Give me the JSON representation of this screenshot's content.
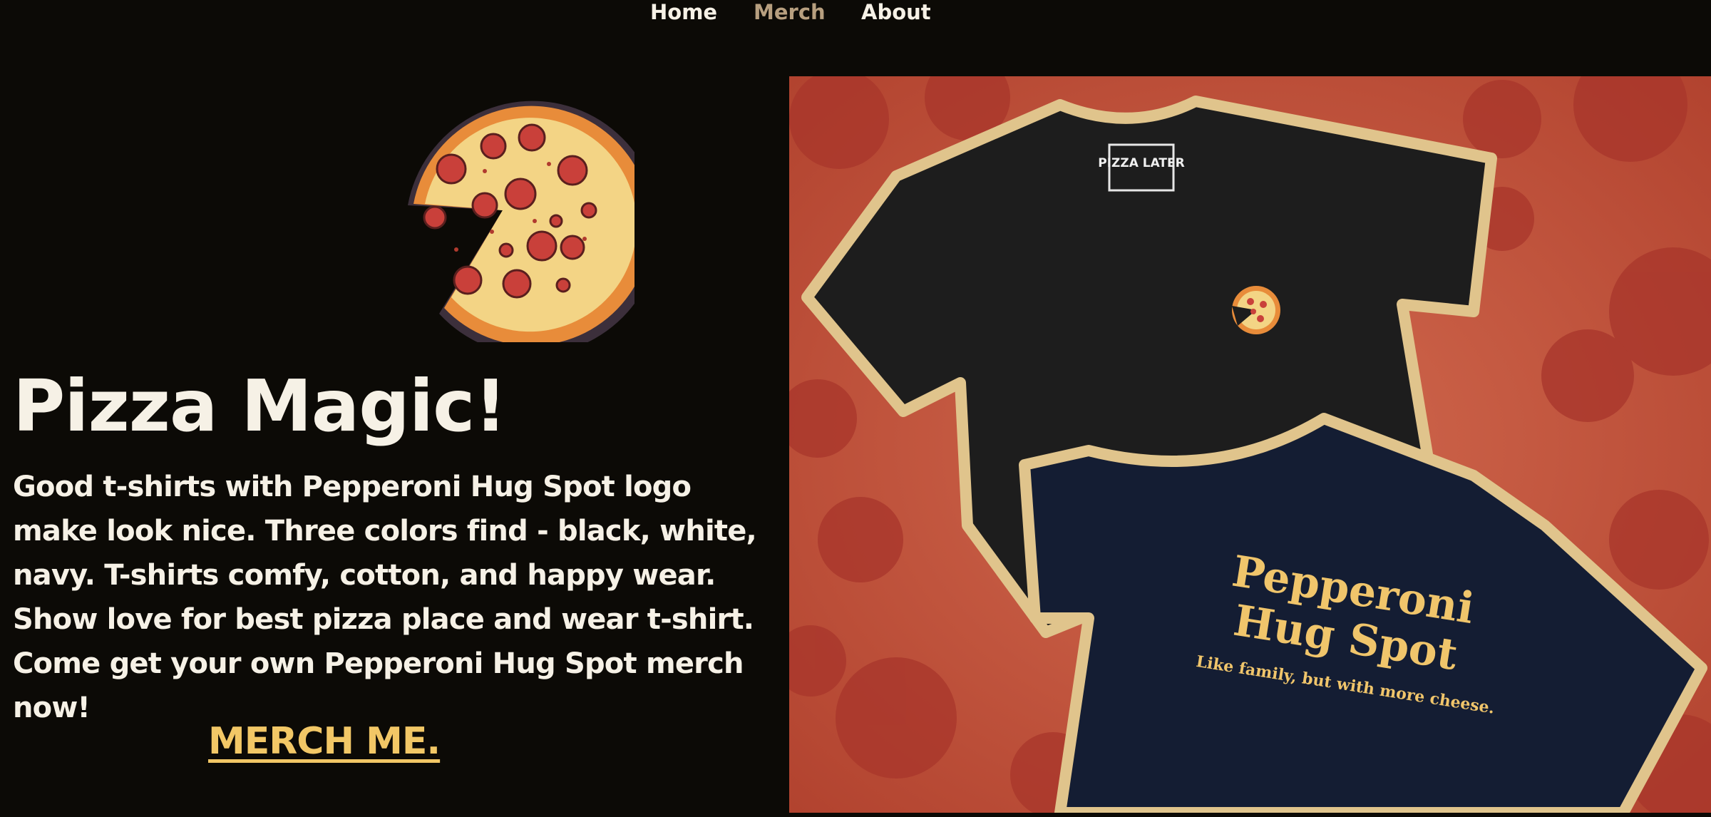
{
  "nav": {
    "items": [
      {
        "label": "Home"
      },
      {
        "label": "Merch"
      },
      {
        "label": "About"
      }
    ]
  },
  "hero": {
    "title": "Pizza Magic!",
    "body": "Good t-shirts with Pepperoni Hug Spot logo make look nice. Three colors find - black, white, navy. T-shirts comfy, cotton, and happy wear. Show love for best pizza place and wear t-shirt. Come get your own Pepperoni Hug Spot merch now!",
    "cta_label": "MERCH ME."
  },
  "photo": {
    "black_shirt_tag": "PIZZA LATER",
    "navy_shirt_brand_line1": "Pepperoni",
    "navy_shirt_brand_line2": "Hug Spot",
    "navy_shirt_tagline": "Like family, but with more cheese."
  },
  "colors": {
    "background": "#0c0a06",
    "text": "#f6f1e6",
    "nav_active": "#b79f7f",
    "cta": "#f2c766",
    "shirt_outline": "#e0c48c",
    "pizza_bg": "#c44f3b"
  }
}
